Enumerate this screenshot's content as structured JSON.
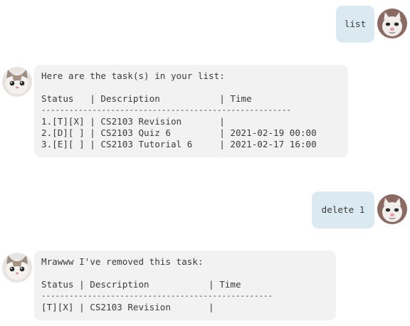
{
  "messages": [
    {
      "sender": "user",
      "text": "list"
    },
    {
      "sender": "bot",
      "lines": [
        "Here are the task(s) in your list:",
        "",
        "Status   | Description           | Time",
        "------------------------------------------------------",
        "1.[T][X] | CS2103 Revision       |",
        "2.[D][ ] | CS2103 Quiz 6         | 2021-02-19 00:00",
        "3.[E][ ] | CS2103 Tutorial 6     | 2021-02-17 16:00"
      ]
    },
    {
      "sender": "user",
      "text": "delete 1"
    },
    {
      "sender": "bot",
      "lines": [
        "Mrawww I've removed this task:",
        "",
        "Status | Description           | Time",
        "--------------------------------------------------",
        "[T][X] | CS2103 Revision       |"
      ]
    }
  ],
  "avatars": {
    "user": "user-cat-avatar",
    "bot": "bot-cat-avatar"
  },
  "colors": {
    "user_bubble": "#dbe9f0",
    "bot_bubble": "#f2f2f2",
    "text": "#3b3b3b"
  }
}
